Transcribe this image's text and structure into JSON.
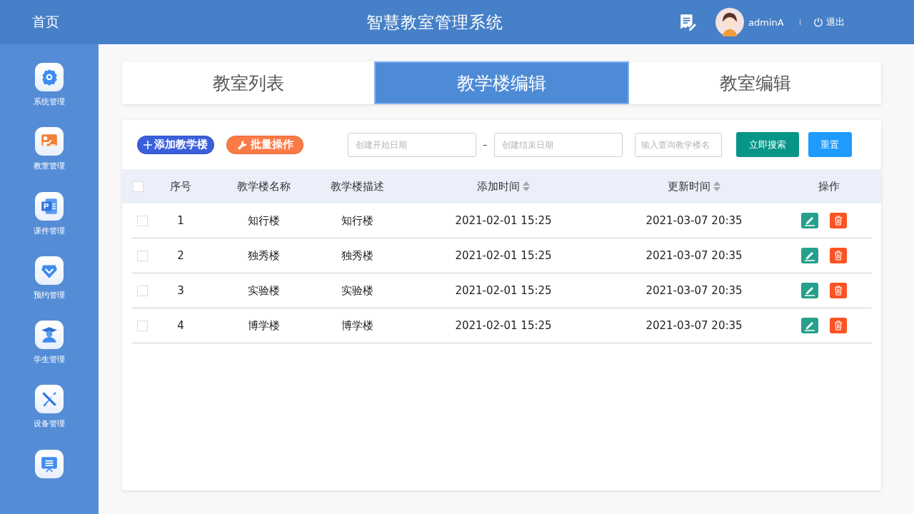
{
  "header": {
    "home": "首页",
    "title": "智慧教室管理系统",
    "user": "adminA",
    "logout": "退出"
  },
  "sidebar": {
    "items": [
      {
        "label": "系统管理"
      },
      {
        "label": "教室管理"
      },
      {
        "label": "课件管理"
      },
      {
        "label": "预约管理"
      },
      {
        "label": "学生管理"
      },
      {
        "label": "设备管理"
      }
    ]
  },
  "tabs": [
    {
      "label": "教室列表",
      "selected": false
    },
    {
      "label": "教学楼编辑",
      "selected": true
    },
    {
      "label": "教室编辑",
      "selected": false
    }
  ],
  "toolbar": {
    "add": "添加教学楼",
    "batch": "批量操作",
    "start_date": {
      "placeholder": "创建开始日期"
    },
    "dash": "–",
    "end_date": {
      "placeholder": "创建结束日期"
    },
    "name_search": {
      "placeholder": "输入查询教学楼名"
    },
    "search": "立即搜索",
    "reset": "重置"
  },
  "table": {
    "all_checked": false,
    "columns": [
      {
        "label": "序号",
        "sortable": false
      },
      {
        "label": "教学楼名称",
        "sortable": false
      },
      {
        "label": "教学楼描述",
        "sortable": false
      },
      {
        "label": "添加时间",
        "sortable": true
      },
      {
        "label": "更新时间",
        "sortable": true
      },
      {
        "label": "操作",
        "sortable": false
      }
    ],
    "rows": [
      {
        "checked": false,
        "cells": [
          "1",
          "知行楼",
          "知行楼",
          "2021-02-01 15:25",
          "2021-03-07 20:35"
        ]
      },
      {
        "checked": false,
        "cells": [
          "2",
          "独秀楼",
          "独秀楼",
          "2021-02-01 15:25",
          "2021-03-07 20:35"
        ]
      },
      {
        "checked": false,
        "cells": [
          "3",
          "实验楼",
          "实验楼",
          "2021-02-01 15:25",
          "2021-03-07 20:35"
        ]
      },
      {
        "checked": false,
        "cells": [
          "4",
          "博学楼",
          "博学楼",
          "2021-02-01 15:25",
          "2021-03-07 20:35"
        ]
      }
    ]
  }
}
